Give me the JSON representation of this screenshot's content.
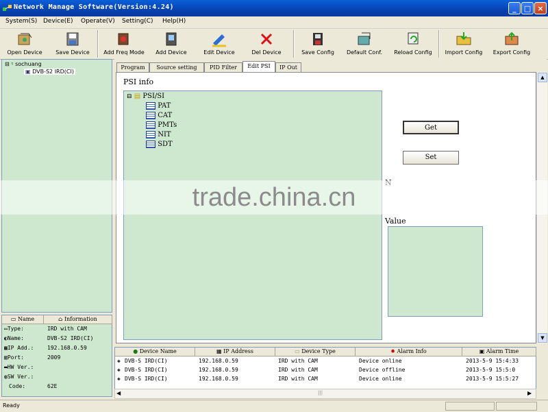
{
  "window": {
    "title": "Network Manage Software(Version:4.24)"
  },
  "menu": [
    "System(S)",
    "Device(E)",
    "Operate(V)",
    "Setting(C)",
    "Help(H)"
  ],
  "toolbar": {
    "open_device": "Open Device",
    "save_device": "Save Device",
    "add_freq_mode": "Add Freq Mode",
    "add_device": "Add Device",
    "edit_device": "Edit Device",
    "del_device": "Del Device",
    "save_config": "Save Config",
    "default_conf": "Default Conf.",
    "reload_config": "Reload Config",
    "import_config": "Import Config",
    "export_config": "Export Config"
  },
  "tree": {
    "root": "sochuang",
    "device": "DVB-S2 IRD(CI)"
  },
  "info": {
    "headers": [
      "Name",
      "Information"
    ],
    "rows": [
      {
        "name": "Type:",
        "value": "IRD with CAM"
      },
      {
        "name": "Name:",
        "value": "DVB-S2 IRD(CI)"
      },
      {
        "name": "IP Add.:",
        "value": "192.168.0.59"
      },
      {
        "name": "Port:",
        "value": "2009"
      },
      {
        "name": "HW Ver.:",
        "value": ""
      },
      {
        "name": "SW Ver.:",
        "value": ""
      },
      {
        "name": "Code:",
        "value": "62E"
      }
    ]
  },
  "tabs": [
    "Program",
    "Source setting",
    "PID Filter",
    "Edit PSI",
    "IP Out"
  ],
  "psi": {
    "section_title": "PSI info",
    "root": "PSI/SI",
    "items": [
      "PAT",
      "CAT",
      "PMTs",
      "NIT",
      "SDT"
    ],
    "get_button": "Get",
    "set_button": "Set",
    "n_label": "N",
    "value_label": "Value"
  },
  "alarm": {
    "headers": [
      "Device Name",
      "IP Address",
      "Device Type",
      "Alarm Info",
      "Alarm Time"
    ],
    "rows": [
      [
        "DVB-S IRD(CI)",
        "192.168.0.59",
        "IRD with CAM",
        "Device online",
        "2013-5-9 15:4:33"
      ],
      [
        "DVB-S IRD(CI)",
        "192.168.0.59",
        "IRD with CAM",
        "Device offline",
        "2013-5-9 15:5:0"
      ],
      [
        "DVB-S IRD(CI)",
        "192.168.0.59",
        "IRD with CAM",
        "Device online",
        "2013-5-9 15:5:27"
      ]
    ]
  },
  "status": {
    "text": "Ready"
  },
  "watermark": "trade.china.cn",
  "colors": {
    "panel_green": "#cde8cf",
    "titlebar_blue": "#0842b0"
  }
}
